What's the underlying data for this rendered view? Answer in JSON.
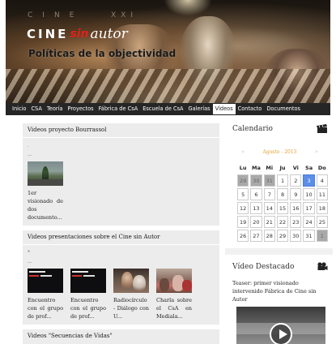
{
  "header": {
    "top_left_text": "CINE",
    "top_right_text": "XXI",
    "logo_cine": "CINE",
    "logo_sin": "sin",
    "logo_autor": "autor",
    "tagline": "Políticas de la objectividad"
  },
  "nav": {
    "items": [
      {
        "label": "Inicio"
      },
      {
        "label": "CSA"
      },
      {
        "label": "Teoría"
      },
      {
        "label": "Proyectos"
      },
      {
        "label": "Fábrica de CsA"
      },
      {
        "label": "Escuela de CsA"
      },
      {
        "label": "Galerías"
      },
      {
        "label": "Vídeos"
      },
      {
        "label": "Contacto"
      },
      {
        "label": "Documentos"
      }
    ],
    "active": "Vídeos"
  },
  "sections": [
    {
      "title": "Videos proyecto Bourrassol",
      "mark": ".",
      "dots": "...",
      "videos": [
        {
          "caption": "1er visionado de dos documento...",
          "thumb": "tree"
        }
      ]
    },
    {
      "title": "Videos presentaciones sobre el Cine sin Autor",
      "mark": "*",
      "dots": "...",
      "videos": [
        {
          "caption": "Encuentro con el grupo de prof...",
          "thumb": "dark"
        },
        {
          "caption": "Encuentro con el grupo de prof...",
          "thumb": "dark"
        },
        {
          "caption": "Radiocírculo - Diálogo con U...",
          "thumb": "people"
        },
        {
          "caption": "Charla sobre el CsA en Mediala...",
          "thumb": "crowd"
        }
      ]
    },
    {
      "title": "Videos \"Secuencias de Vidas\""
    }
  ],
  "sidebar": {
    "calendar_title": "Calendario",
    "month_label": "Agosto - 2013",
    "prev_arrow": "«",
    "next_arrow": "»",
    "weekdays": [
      "Lu",
      "Ma",
      "Mi",
      "Ju",
      "Vi",
      "Sa",
      "Do"
    ],
    "weeks": [
      [
        "29",
        "30",
        "31",
        "1",
        "2",
        "3",
        "4"
      ],
      [
        "5",
        "6",
        "7",
        "8",
        "9",
        "10",
        "11"
      ],
      [
        "12",
        "13",
        "14",
        "15",
        "16",
        "17",
        "18"
      ],
      [
        "19",
        "20",
        "21",
        "22",
        "23",
        "24",
        "25"
      ],
      [
        "26",
        "27",
        "28",
        "29",
        "30",
        "31",
        "1"
      ]
    ],
    "today": "3",
    "video_title": "Vídeo Destacado",
    "teaser": "Teaser: primer visionado intervenido Fábrica de Cine sin Autor"
  },
  "colors": {
    "nav_bg": "#262626",
    "box_bg": "#ececec",
    "today_bg": "#5a8ee8",
    "month_color": "#e0a030",
    "logo_red": "#e0201a"
  }
}
